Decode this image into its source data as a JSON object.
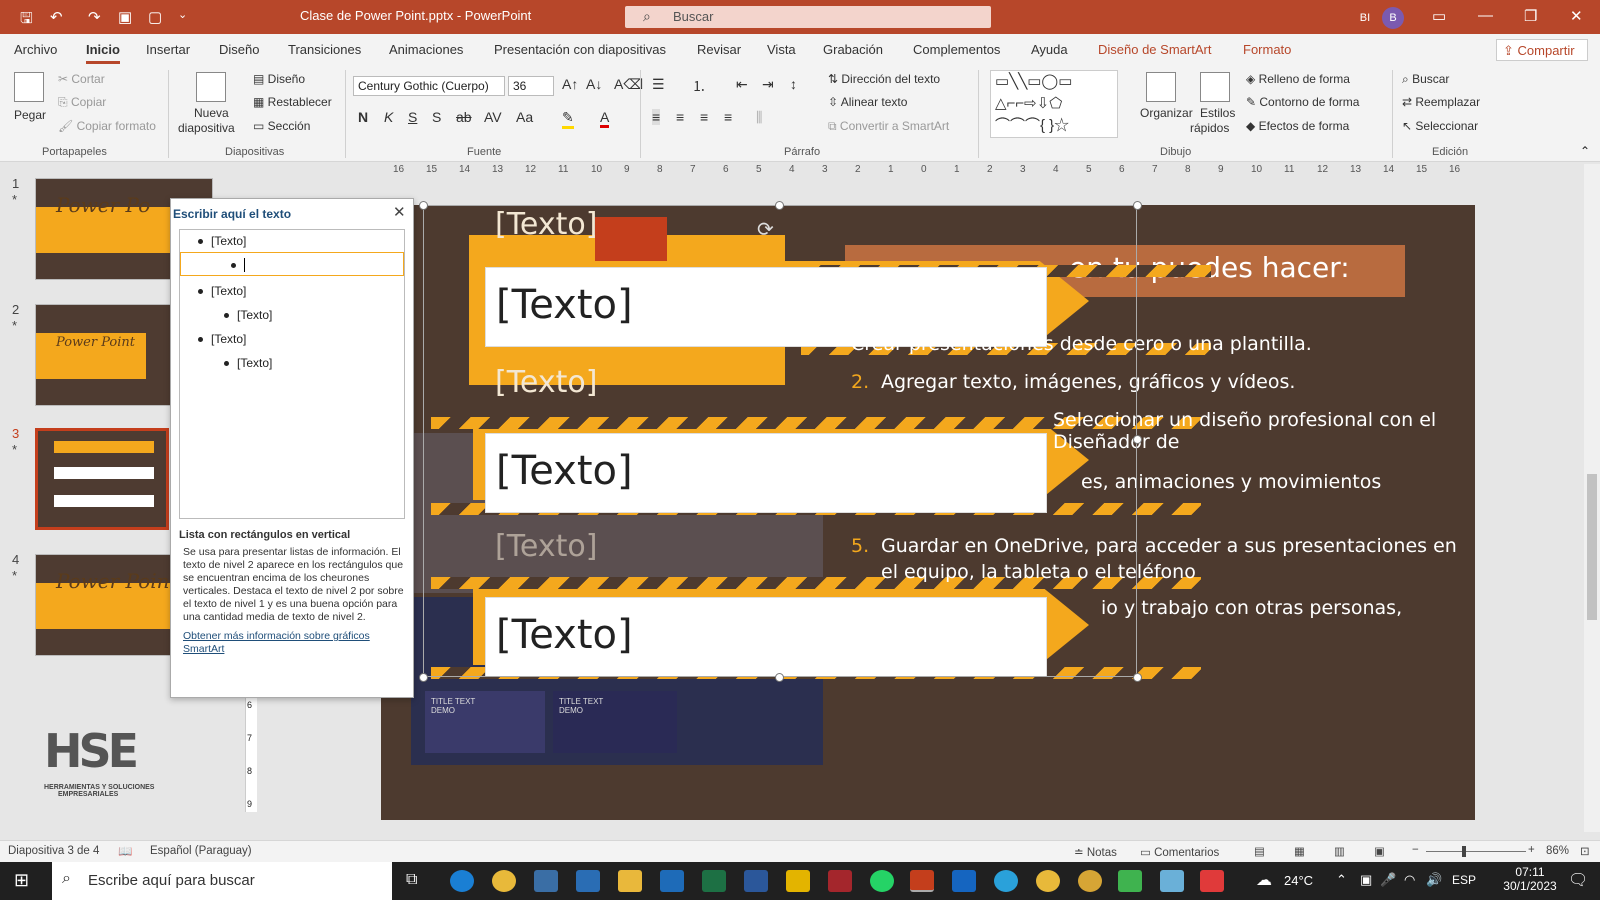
{
  "titlebar": {
    "filename": "Clase de Power Point.pptx",
    "separator": "-",
    "app": "PowerPoint",
    "search_placeholder": "Buscar",
    "user_initials": "BI",
    "avatar_letter": "B"
  },
  "menu": {
    "items": [
      "Archivo",
      "Inicio",
      "Insertar",
      "Diseño",
      "Transiciones",
      "Animaciones",
      "Presentación con diapositivas",
      "Revisar",
      "Vista",
      "Grabación",
      "Complementos",
      "Ayuda",
      "Diseño de SmartArt",
      "Formato"
    ],
    "share": "Compartir"
  },
  "ribbon": {
    "portapapeles": {
      "paste": "Pegar",
      "cut": "Cortar",
      "copy": "Copiar",
      "format_painter": "Copiar formato",
      "label": "Portapapeles"
    },
    "diapositivas": {
      "new_slide": "Nueva",
      "new_slide2": "diapositiva",
      "layout": "Diseño",
      "reset": "Restablecer",
      "section": "Sección",
      "label": "Diapositivas"
    },
    "fuente": {
      "font": "Century Gothic (Cuerpo)",
      "size": "36",
      "bold": "N",
      "italic": "K",
      "underline": "S",
      "shadow": "S",
      "strike": "ab",
      "case": "Aa",
      "label": "Fuente"
    },
    "parrafo": {
      "text_dir": "Dirección del texto",
      "align_text": "Alinear texto",
      "convert": "Convertir a SmartArt",
      "label": "Párrafo"
    },
    "dibujo": {
      "arrange": "Organizar",
      "quick_styles": "Estilos",
      "quick_styles2": "rápidos",
      "fill": "Relleno de forma",
      "outline": "Contorno de forma",
      "effects": "Efectos de forma",
      "label": "Dibujo"
    },
    "edicion": {
      "find": "Buscar",
      "replace": "Reemplazar",
      "select": "Seleccionar",
      "label": "Edición"
    }
  },
  "thumbnails": [
    {
      "num": "1",
      "title": "Power Po"
    },
    {
      "num": "2",
      "title": "Power Point"
    },
    {
      "num": "3",
      "title": ""
    },
    {
      "num": "4",
      "title": "Power Poin"
    }
  ],
  "ruler_ticks": [
    "16",
    "15",
    "14",
    "13",
    "12",
    "11",
    "10",
    "9",
    "8",
    "7",
    "6",
    "5",
    "4",
    "3",
    "2",
    "1",
    "0",
    "1",
    "2",
    "3",
    "4",
    "5",
    "6",
    "7",
    "8",
    "9",
    "10",
    "11",
    "12",
    "13",
    "14",
    "15",
    "16"
  ],
  "vruler_ticks": [
    "6",
    "7",
    "8",
    "9"
  ],
  "slide": {
    "heading": "en tu puedes hacer:",
    "placeholders": [
      "[Texto]",
      "[Texto]",
      "[Texto]",
      "[Texto]"
    ],
    "boxes": [
      "[Texto]",
      "[Texto]",
      "[Texto]"
    ],
    "list": [
      {
        "n": "",
        "text": "Crear presentaciones desde cero o una plantilla."
      },
      {
        "n": "2.",
        "text": "Agregar texto, imágenes, gráficos y vídeos."
      },
      {
        "n": "",
        "text": "Seleccionar un diseño profesional con el Diseñador de"
      },
      {
        "n": "",
        "text": "es,     animaciones     y     movimientos"
      },
      {
        "n": "5.",
        "text": "Guardar en OneDrive, para acceder a sus presentaciones en"
      },
      {
        "n": "",
        "text": "el equipo, la tableta o el teléfono"
      },
      {
        "n": "",
        "text": "io  y  trabajo  con  otras  personas,"
      }
    ],
    "demo_text": [
      "TITLE TEXT",
      "DEMO"
    ]
  },
  "textpane": {
    "title": "Escribir aquí el texto",
    "items": [
      {
        "level": 1,
        "text": "[Texto]"
      },
      {
        "level": 2,
        "text": "",
        "active": true
      },
      {
        "level": 1,
        "text": "[Texto]"
      },
      {
        "level": 2,
        "text": "[Texto]"
      },
      {
        "level": 1,
        "text": "[Texto]"
      },
      {
        "level": 2,
        "text": "[Texto]"
      }
    ],
    "desc_title": "Lista con rectángulos en vertical",
    "desc": "Se usa para presentar listas de información. El texto de nivel 2 aparece en los rectángulos que se encuentran encima de los cheurones verticales. Destaca el texto de nivel 2 por sobre el texto de nivel 1 y es una buena opción para una cantidad media de texto de nivel 2.",
    "link": "Obtener más información sobre gráficos SmartArt"
  },
  "logo": {
    "line1": "HERRAMIENTAS Y SOLUCIONES",
    "line2": "EMPRESARIALES"
  },
  "status": {
    "slide_info": "Diapositiva 3 de 4",
    "language": "Español (Paraguay)",
    "notes": "Notas",
    "comments": "Comentarios",
    "zoom": "86%"
  },
  "taskbar": {
    "search": "Escribe aquí para buscar",
    "temp": "24°C",
    "lang": "ESP",
    "time": "07:11",
    "date": "30/1/2023"
  }
}
